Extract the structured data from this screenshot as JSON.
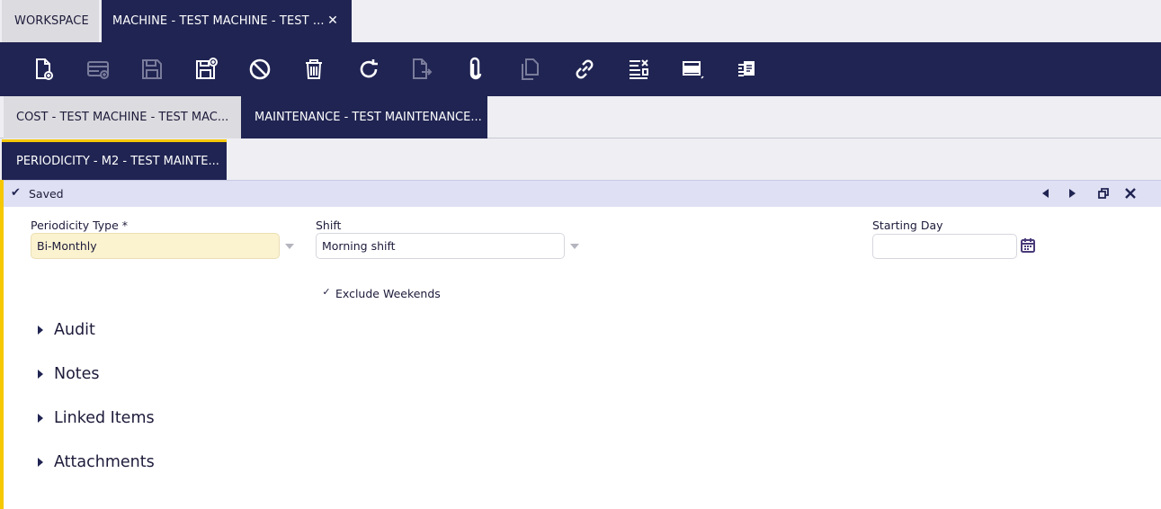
{
  "top_tabs": {
    "workspace": "WORKSPACE",
    "active": "MACHINE - TEST MACHINE - TEST ...",
    "close_glyph": "✕"
  },
  "toolbar": {
    "buttons": [
      {
        "name": "new-document-icon",
        "state": "enabled"
      },
      {
        "name": "new-row-icon",
        "state": "disabled"
      },
      {
        "name": "save-icon",
        "state": "disabled"
      },
      {
        "name": "save-and-new-icon",
        "state": "enabled"
      },
      {
        "name": "undo-cancel-icon",
        "state": "enabled"
      },
      {
        "name": "delete-icon",
        "state": "enabled"
      },
      {
        "name": "refresh-icon",
        "state": "enabled"
      },
      {
        "name": "export-icon",
        "state": "disabled"
      },
      {
        "name": "attachment-icon",
        "state": "enabled"
      },
      {
        "name": "copy-record-icon",
        "state": "disabled"
      },
      {
        "name": "link-icon",
        "state": "enabled"
      },
      {
        "name": "tools-list-icon",
        "state": "enabled"
      },
      {
        "name": "grid-view-icon",
        "state": "enabled"
      },
      {
        "name": "clone-form-icon",
        "state": "enabled"
      }
    ]
  },
  "subtabs": {
    "cost": "COST - TEST MACHINE - TEST MAC...",
    "maintenance": "MAINTENANCE - TEST MAINTENANCE...",
    "periodicity": "PERIODICITY - M2 - TEST MAINTE..."
  },
  "status": {
    "check_glyph": "✔",
    "text": "Saved"
  },
  "form": {
    "periodicity_type": {
      "label": "Periodicity Type *",
      "value": "Bi-Monthly"
    },
    "shift": {
      "label": "Shift",
      "value": "Morning shift"
    },
    "starting_day": {
      "label": "Starting Day",
      "value": ""
    },
    "exclude_weekends": {
      "label": "Exclude Weekends",
      "checked": true,
      "check_glyph": "✓"
    }
  },
  "sections": [
    "Audit",
    "Notes",
    "Linked Items",
    "Attachments"
  ],
  "colors": {
    "navy": "#202452",
    "accent_yellow": "#f5c800",
    "status_bg": "#dfe0f3",
    "required_bg": "#fbf2d0",
    "disabled_icon": "#7a7c9b"
  }
}
